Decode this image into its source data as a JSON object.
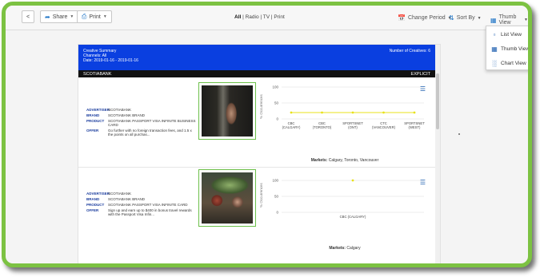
{
  "toolbar": {
    "back_glyph": "<",
    "share_label": "Share",
    "print_label": "Print",
    "center_tabs": {
      "active": "All",
      "rest": " | Radio | TV | Print"
    },
    "change_period_label": "Change Period",
    "sort_by_label": "Sort By",
    "thumb_view_label": "Thumb View"
  },
  "view_menu": {
    "items": [
      {
        "label": "List View",
        "icon": "list-view-icon"
      },
      {
        "label": "Thumb View",
        "icon": "thumb-grid-icon"
      },
      {
        "label": "Chart View",
        "icon": "bar-chart-icon"
      }
    ]
  },
  "report": {
    "summary_title": "Creative Summary",
    "channels": "Channels: All",
    "date": "Date: 2019-01-16 - 2019-01-16",
    "creatives_count": "Number of Creatives: 6",
    "brand_bar_left": "SCOTIABANK",
    "brand_bar_right": "EXPLICIT",
    "ads": [
      {
        "advertiser_key": "ADVERTISER",
        "advertiser": "SCOTIABANK",
        "brand_key": "BRAND",
        "brand": "SCOTIABANK BRAND",
        "product_key": "PRODUCT",
        "product": "SCOTIABANK PASSPORT VISA INFINITE BUSINESS CARD",
        "offer_key": "OFFER",
        "offer": "Go further with no foreign transaction fees, and 1.5 x the points on all purchas...",
        "markets_key": "Markets:",
        "markets": "Calgary, Toronto, Vancouver",
        "ylabel": "% Occurrences"
      },
      {
        "advertiser_key": "ADVERTISER",
        "advertiser": "SCOTIABANK",
        "brand_key": "BRAND",
        "brand": "SCOTIABANK BRAND",
        "product_key": "PRODUCT",
        "product": "SCOTIABANK PASSPORT VISA INFINITE CARD",
        "offer_key": "OFFER",
        "offer": "Sign up and earn up to $400 in bonus travel rewards with the Passport Visa Infin...",
        "markets_key": "Markets:",
        "markets": "Calgary",
        "ylabel": "% Occurrences"
      }
    ]
  },
  "chart_data": [
    {
      "type": "line",
      "categories": [
        "CBC (CALGARY)",
        "CBC (TORONTO)",
        "SPORTSNET (ONT)",
        "CTC (VANCOUVER)",
        "SPORTSNET (WEST)"
      ],
      "values": [
        20,
        20,
        20,
        20,
        20
      ],
      "yticks": [
        "100",
        "50",
        "0"
      ],
      "ylim": [
        0,
        100
      ],
      "color": "#e8e11a"
    },
    {
      "type": "line",
      "categories": [
        "CBC (CALGARY)"
      ],
      "values": [
        100
      ],
      "yticks": [
        "100",
        "50",
        "0"
      ],
      "ylim": [
        0,
        100
      ],
      "color": "#e8e11a"
    }
  ]
}
